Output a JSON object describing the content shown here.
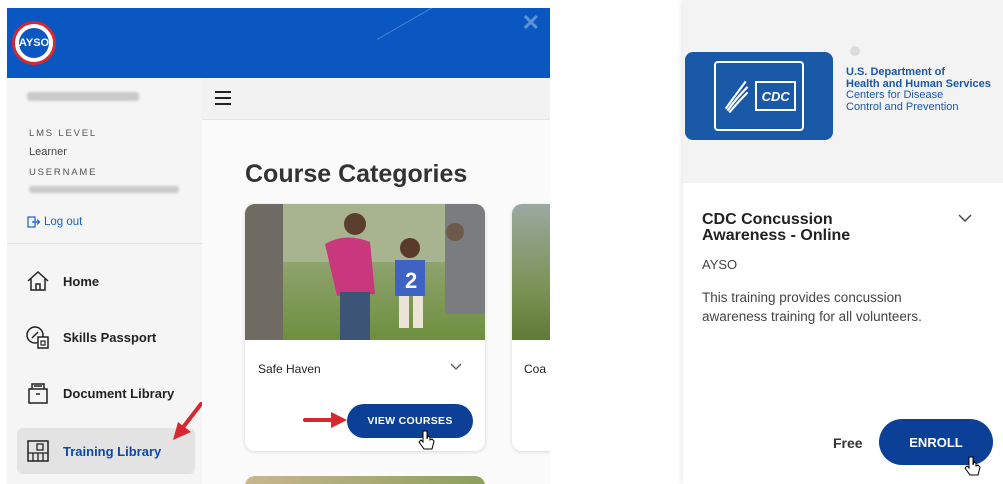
{
  "sidebar": {
    "lms_level_label": "LMS LEVEL",
    "lms_level_value": "Learner",
    "username_label": "USERNAME",
    "logout_label": "Log out",
    "items": [
      {
        "label": "Home",
        "icon": "home-icon"
      },
      {
        "label": "Skills Passport",
        "icon": "skills-passport-icon"
      },
      {
        "label": "Document Library",
        "icon": "document-library-icon"
      },
      {
        "label": "Training Library",
        "icon": "training-library-icon",
        "active": true
      }
    ]
  },
  "main": {
    "title": "Course Categories",
    "cards": [
      {
        "title": "Safe Haven",
        "button": "VIEW COURSES"
      },
      {
        "title": "Coa"
      }
    ]
  },
  "course": {
    "logo_org": "CDC",
    "logo_dept_line1": "U.S. Department of",
    "logo_dept_line2": "Health and Human Services",
    "logo_dept_line3": "Centers for Disease",
    "logo_dept_line4": "Control and Prevention",
    "title": "CDC Concussion Awareness - Online",
    "org": "AYSO",
    "description": "This training provides concussion awareness training for all volunteers.",
    "price": "Free",
    "enroll": "ENROLL"
  },
  "brand": {
    "logo_text": "AYSO"
  },
  "colors": {
    "brand_blue": "#0a57c2",
    "button_navy": "#0c3f96",
    "annotation_red": "#d7282f"
  }
}
